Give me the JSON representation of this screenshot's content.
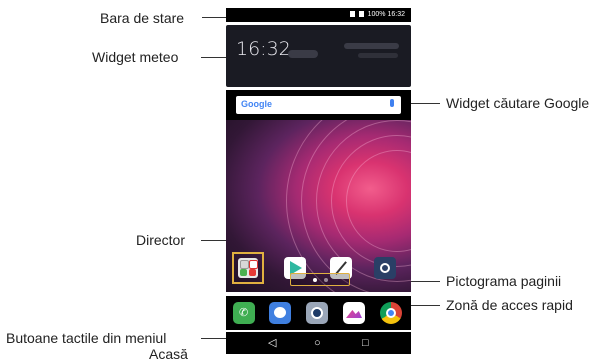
{
  "labels": {
    "status_bar": "Bara de stare",
    "weather_widget": "Widget meteo",
    "google_search_widget": "Widget căutare Google",
    "folder": "Director",
    "page_indicator": "Pictograma paginii",
    "quick_access": "Zonă de acces rapid",
    "home_touch_buttons_line1": "Butoane tactile din meniul",
    "home_touch_buttons_line2": "Acasă"
  },
  "phone": {
    "status_text": "100% 16:32",
    "weather_time": "16:32",
    "search_logo": "Google",
    "nav": {
      "back": "◁",
      "home": "○",
      "recent": "□"
    }
  },
  "colors": {
    "accent_highlight": "#e0b040",
    "screen_bg": "#000000",
    "wallpaper_pink": "#d93370"
  },
  "icons": {
    "status": [
      "signal-icon",
      "battery-icon"
    ],
    "apps": [
      "folder-icon",
      "play-store-icon",
      "pencil-icon",
      "settings-icon"
    ],
    "quick": [
      "phone-icon",
      "messages-icon",
      "camera-icon",
      "gallery-icon",
      "chrome-icon"
    ]
  }
}
